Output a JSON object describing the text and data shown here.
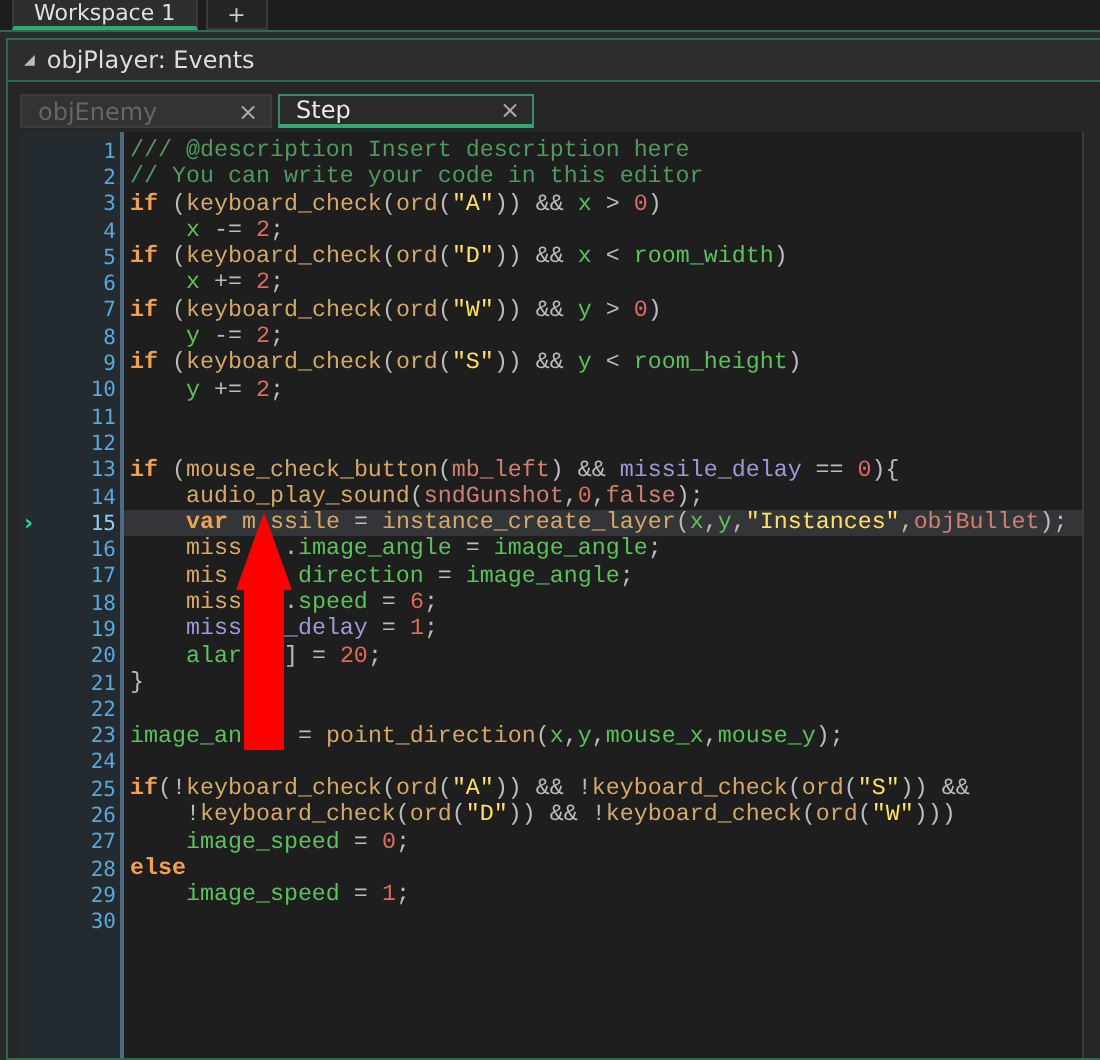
{
  "workspace_tabs": [
    {
      "label": "Workspace 1",
      "selected": true
    },
    {
      "label": "+",
      "selected": false
    }
  ],
  "panel": {
    "title": "objPlayer: Events",
    "collapse_icon": "◢"
  },
  "event_tabs": [
    {
      "label": "objEnemy",
      "close": "×",
      "selected": false
    },
    {
      "label": "Step",
      "close": "×",
      "selected": true
    }
  ],
  "editor": {
    "current_marker": "›",
    "lines": [
      {
        "number": "1",
        "current": false,
        "tokens": [
          {
            "kind": "comment",
            "text": "/// @description Insert description here"
          }
        ]
      },
      {
        "number": "2",
        "current": false,
        "tokens": [
          {
            "kind": "comment",
            "text": "// You can write your code in this editor"
          }
        ]
      },
      {
        "number": "3",
        "current": false,
        "tokens": [
          {
            "kind": "keyword",
            "text": "if"
          },
          {
            "kind": "plain",
            "text": " ("
          },
          {
            "kind": "function",
            "text": "keyboard_check"
          },
          {
            "kind": "plain",
            "text": "("
          },
          {
            "kind": "function",
            "text": "ord"
          },
          {
            "kind": "plain",
            "text": "("
          },
          {
            "kind": "string",
            "text": "\"A\""
          },
          {
            "kind": "plain",
            "text": ")) && "
          },
          {
            "kind": "variable",
            "text": "x"
          },
          {
            "kind": "plain",
            "text": " > "
          },
          {
            "kind": "number",
            "text": "0"
          },
          {
            "kind": "plain",
            "text": ")"
          }
        ]
      },
      {
        "number": "4",
        "current": false,
        "tokens": [
          {
            "kind": "variable",
            "text": "    x"
          },
          {
            "kind": "plain",
            "text": " -= "
          },
          {
            "kind": "number",
            "text": "2"
          },
          {
            "kind": "plain",
            "text": ";"
          }
        ]
      },
      {
        "number": "5",
        "current": false,
        "tokens": [
          {
            "kind": "keyword",
            "text": "if"
          },
          {
            "kind": "plain",
            "text": " ("
          },
          {
            "kind": "function",
            "text": "keyboard_check"
          },
          {
            "kind": "plain",
            "text": "("
          },
          {
            "kind": "function",
            "text": "ord"
          },
          {
            "kind": "plain",
            "text": "("
          },
          {
            "kind": "string",
            "text": "\"D\""
          },
          {
            "kind": "plain",
            "text": ")) && "
          },
          {
            "kind": "variable",
            "text": "x"
          },
          {
            "kind": "plain",
            "text": " < "
          },
          {
            "kind": "variable",
            "text": "room_width"
          },
          {
            "kind": "plain",
            "text": ")"
          }
        ]
      },
      {
        "number": "6",
        "current": false,
        "tokens": [
          {
            "kind": "variable",
            "text": "    x"
          },
          {
            "kind": "plain",
            "text": " += "
          },
          {
            "kind": "number",
            "text": "2"
          },
          {
            "kind": "plain",
            "text": ";"
          }
        ]
      },
      {
        "number": "7",
        "current": false,
        "tokens": [
          {
            "kind": "keyword",
            "text": "if"
          },
          {
            "kind": "plain",
            "text": " ("
          },
          {
            "kind": "function",
            "text": "keyboard_check"
          },
          {
            "kind": "plain",
            "text": "("
          },
          {
            "kind": "function",
            "text": "ord"
          },
          {
            "kind": "plain",
            "text": "("
          },
          {
            "kind": "string",
            "text": "\"W\""
          },
          {
            "kind": "plain",
            "text": ")) && "
          },
          {
            "kind": "variable",
            "text": "y"
          },
          {
            "kind": "plain",
            "text": " > "
          },
          {
            "kind": "number",
            "text": "0"
          },
          {
            "kind": "plain",
            "text": ")"
          }
        ]
      },
      {
        "number": "8",
        "current": false,
        "tokens": [
          {
            "kind": "variable",
            "text": "    y"
          },
          {
            "kind": "plain",
            "text": " -= "
          },
          {
            "kind": "number",
            "text": "2"
          },
          {
            "kind": "plain",
            "text": ";"
          }
        ]
      },
      {
        "number": "9",
        "current": false,
        "tokens": [
          {
            "kind": "keyword",
            "text": "if"
          },
          {
            "kind": "plain",
            "text": " ("
          },
          {
            "kind": "function",
            "text": "keyboard_check"
          },
          {
            "kind": "plain",
            "text": "("
          },
          {
            "kind": "function",
            "text": "ord"
          },
          {
            "kind": "plain",
            "text": "("
          },
          {
            "kind": "string",
            "text": "\"S\""
          },
          {
            "kind": "plain",
            "text": ")) && "
          },
          {
            "kind": "variable",
            "text": "y"
          },
          {
            "kind": "plain",
            "text": " < "
          },
          {
            "kind": "variable",
            "text": "room_height"
          },
          {
            "kind": "plain",
            "text": ")"
          }
        ]
      },
      {
        "number": "10",
        "current": false,
        "tokens": [
          {
            "kind": "variable",
            "text": "    y"
          },
          {
            "kind": "plain",
            "text": " += "
          },
          {
            "kind": "number",
            "text": "2"
          },
          {
            "kind": "plain",
            "text": ";"
          }
        ]
      },
      {
        "number": "11",
        "current": false
      },
      {
        "number": "12",
        "current": false
      },
      {
        "number": "13",
        "current": false,
        "tokens": [
          {
            "kind": "keyword",
            "text": "if"
          },
          {
            "kind": "plain",
            "text": " ("
          },
          {
            "kind": "function",
            "text": "mouse_check_button"
          },
          {
            "kind": "plain",
            "text": "("
          },
          {
            "kind": "constant",
            "text": "mb_left"
          },
          {
            "kind": "plain",
            "text": ") && "
          },
          {
            "kind": "instance",
            "text": "missile_delay"
          },
          {
            "kind": "plain",
            "text": " == "
          },
          {
            "kind": "number",
            "text": "0"
          },
          {
            "kind": "plain",
            "text": "){"
          }
        ]
      },
      {
        "number": "14",
        "current": false,
        "tokens": [
          {
            "kind": "function",
            "text": "    audio_play_sound"
          },
          {
            "kind": "plain",
            "text": "("
          },
          {
            "kind": "constant",
            "text": "sndGunshot"
          },
          {
            "kind": "plain",
            "text": ","
          },
          {
            "kind": "number",
            "text": "0"
          },
          {
            "kind": "plain",
            "text": ","
          },
          {
            "kind": "constant",
            "text": "false"
          },
          {
            "kind": "plain",
            "text": ");"
          }
        ]
      },
      {
        "number": "15",
        "current": true,
        "tokens": [
          {
            "kind": "keyword",
            "text": "    var"
          },
          {
            "kind": "local",
            "text": " m"
          },
          {
            "kind": "local",
            "text": " ssile"
          },
          {
            "kind": "plain",
            "text": " = "
          },
          {
            "kind": "function",
            "text": "instance_create_layer"
          },
          {
            "kind": "plain",
            "text": "("
          },
          {
            "kind": "variable",
            "text": "x"
          },
          {
            "kind": "plain",
            "text": ","
          },
          {
            "kind": "variable",
            "text": "y"
          },
          {
            "kind": "plain",
            "text": ","
          },
          {
            "kind": "string",
            "text": "\"Instances\""
          },
          {
            "kind": "plain",
            "text": ","
          },
          {
            "kind": "constant",
            "text": "objBullet"
          },
          {
            "kind": "plain",
            "text": ");"
          }
        ]
      },
      {
        "number": "16",
        "current": false,
        "tokens": [
          {
            "kind": "local",
            "text": "    miss"
          },
          {
            "kind": "plain",
            "text": "   ."
          },
          {
            "kind": "variable",
            "text": "image_angle"
          },
          {
            "kind": "plain",
            "text": " = "
          },
          {
            "kind": "variable",
            "text": "image_angle"
          },
          {
            "kind": "plain",
            "text": ";"
          }
        ]
      },
      {
        "number": "17",
        "current": false,
        "tokens": [
          {
            "kind": "local",
            "text": "    mis"
          },
          {
            "kind": "variable",
            "text": "     direction"
          },
          {
            "kind": "plain",
            "text": " = "
          },
          {
            "kind": "variable",
            "text": "image_angle"
          },
          {
            "kind": "plain",
            "text": ";"
          }
        ]
      },
      {
        "number": "18",
        "current": false,
        "tokens": [
          {
            "kind": "local",
            "text": "    miss"
          },
          {
            "kind": "plain",
            "text": "   ."
          },
          {
            "kind": "variable",
            "text": "speed"
          },
          {
            "kind": "plain",
            "text": " = "
          },
          {
            "kind": "number",
            "text": "6"
          },
          {
            "kind": "plain",
            "text": ";"
          }
        ]
      },
      {
        "number": "19",
        "current": false,
        "tokens": [
          {
            "kind": "instance",
            "text": "    miss"
          },
          {
            "kind": "instance",
            "text": "   _delay"
          },
          {
            "kind": "plain",
            "text": " = "
          },
          {
            "kind": "number",
            "text": "1"
          },
          {
            "kind": "plain",
            "text": ";"
          }
        ]
      },
      {
        "number": "20",
        "current": false,
        "tokens": [
          {
            "kind": "variable",
            "text": "    alar"
          },
          {
            "kind": "plain",
            "text": "   ] = "
          },
          {
            "kind": "number",
            "text": "20"
          },
          {
            "kind": "plain",
            "text": ";"
          }
        ]
      },
      {
        "number": "21",
        "current": false,
        "tokens": [
          {
            "kind": "plain",
            "text": "}"
          }
        ]
      },
      {
        "number": "22",
        "current": false
      },
      {
        "number": "23",
        "current": false,
        "tokens": [
          {
            "kind": "variable",
            "text": "image_an"
          },
          {
            "kind": "plain",
            "text": "    = "
          },
          {
            "kind": "function",
            "text": "point_direction"
          },
          {
            "kind": "plain",
            "text": "("
          },
          {
            "kind": "variable",
            "text": "x"
          },
          {
            "kind": "plain",
            "text": ","
          },
          {
            "kind": "variable",
            "text": "y"
          },
          {
            "kind": "plain",
            "text": ","
          },
          {
            "kind": "variable",
            "text": "mouse_x"
          },
          {
            "kind": "plain",
            "text": ","
          },
          {
            "kind": "variable",
            "text": "mouse_y"
          },
          {
            "kind": "plain",
            "text": ");"
          }
        ]
      },
      {
        "number": "24",
        "current": false
      },
      {
        "number": "25",
        "current": false,
        "tokens": [
          {
            "kind": "keyword",
            "text": "if"
          },
          {
            "kind": "plain",
            "text": "(!"
          },
          {
            "kind": "function",
            "text": "keyboard_check"
          },
          {
            "kind": "plain",
            "text": "("
          },
          {
            "kind": "function",
            "text": "ord"
          },
          {
            "kind": "plain",
            "text": "("
          },
          {
            "kind": "string",
            "text": "\"A\""
          },
          {
            "kind": "plain",
            "text": ")) && !"
          },
          {
            "kind": "function",
            "text": "keyboard_check"
          },
          {
            "kind": "plain",
            "text": "("
          },
          {
            "kind": "function",
            "text": "ord"
          },
          {
            "kind": "plain",
            "text": "("
          },
          {
            "kind": "string",
            "text": "\"S\""
          },
          {
            "kind": "plain",
            "text": ")) &&"
          }
        ]
      },
      {
        "number": "26",
        "current": false,
        "tokens": [
          {
            "kind": "plain",
            "text": "    !"
          },
          {
            "kind": "function",
            "text": "keyboard_check"
          },
          {
            "kind": "plain",
            "text": "("
          },
          {
            "kind": "function",
            "text": "ord"
          },
          {
            "kind": "plain",
            "text": "("
          },
          {
            "kind": "string",
            "text": "\"D\""
          },
          {
            "kind": "plain",
            "text": ")) && !"
          },
          {
            "kind": "function",
            "text": "keyboard_check"
          },
          {
            "kind": "plain",
            "text": "("
          },
          {
            "kind": "function",
            "text": "ord"
          },
          {
            "kind": "plain",
            "text": "("
          },
          {
            "kind": "string",
            "text": "\"W\""
          },
          {
            "kind": "plain",
            "text": ")))"
          }
        ]
      },
      {
        "number": "27",
        "current": false,
        "tokens": [
          {
            "kind": "variable",
            "text": "    image_speed"
          },
          {
            "kind": "plain",
            "text": " = "
          },
          {
            "kind": "number",
            "text": "0"
          },
          {
            "kind": "plain",
            "text": ";"
          }
        ]
      },
      {
        "number": "28",
        "current": false,
        "tokens": [
          {
            "kind": "keyword",
            "text": "else"
          }
        ]
      },
      {
        "number": "29",
        "current": false,
        "tokens": [
          {
            "kind": "variable",
            "text": "    image_speed"
          },
          {
            "kind": "plain",
            "text": " = "
          },
          {
            "kind": "number",
            "text": "1"
          },
          {
            "kind": "plain",
            "text": ";"
          }
        ]
      },
      {
        "number": "30",
        "current": false
      }
    ]
  }
}
